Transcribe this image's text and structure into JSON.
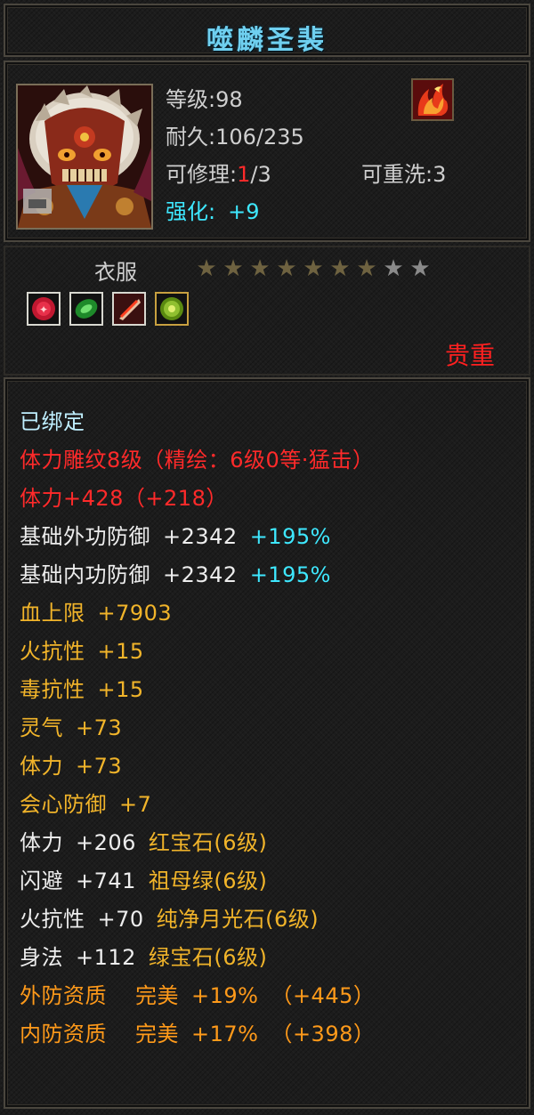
{
  "item": {
    "name": "噬麟圣裴",
    "level_label": "等级",
    "level": "98",
    "durability_label": "耐久",
    "durability": "106/235",
    "repair_label": "可修理",
    "repair_used": "1",
    "repair_max": "/3",
    "reset_label": "可重洗",
    "reset_count": "3",
    "enhance_label": "强化",
    "enhance_value": "+9",
    "category": "衣服",
    "stars_filled": 7,
    "stars_total": 9,
    "rarity": "贵重",
    "icons": {
      "portrait": "armor-portrait-icon",
      "item": "flame-emblem-icon",
      "gems": [
        "red-gem-icon",
        "green-gem-icon",
        "moonstone-icon",
        "emerald-icon"
      ]
    }
  },
  "attributes": {
    "bound": "已绑定",
    "engrave": "体力雕纹8级（精绘：6级0等·猛击）",
    "stamina_label": "体力+428",
    "stamina_bonus": "（+218）",
    "ext_def_label": "基础外功防御",
    "ext_def_value": "+2342",
    "ext_def_pct": "+195%",
    "int_def_label": "基础内功防御",
    "int_def_value": "+2342",
    "int_def_pct": "+195%",
    "hp_label": "血上限",
    "hp_value": "+7903",
    "fire_res_label": "火抗性",
    "fire_res_value": "+15",
    "poison_res_label": "毒抗性",
    "poison_res_value": "+15",
    "spirit_label": "灵气",
    "spirit_value": "+73",
    "body_label": "体力",
    "body_value": "+73",
    "crit_def_label": "会心防御",
    "crit_def_value": "+7"
  },
  "gems": [
    {
      "stat": "体力",
      "value": "+206",
      "name": "红宝石(6级)"
    },
    {
      "stat": "闪避",
      "value": "+741",
      "name": "祖母绿(6级)"
    },
    {
      "stat": "火抗性",
      "value": "+70",
      "name": "纯净月光石(6级)"
    },
    {
      "stat": "身法",
      "value": "+112",
      "name": "绿宝石(6级)"
    }
  ],
  "quality": [
    {
      "label": "外防资质",
      "grade": "完美",
      "pct": "+19%",
      "bonus": "（+445）"
    },
    {
      "label": "内防资质",
      "grade": "完美",
      "pct": "+17%",
      "bonus": "（+398）"
    }
  ],
  "colors": {
    "title": "#6fd0f0",
    "red": "#ff2a2a",
    "cyan": "#3ee8ff",
    "yellow": "#f1b42a",
    "orange": "#ff9a1a",
    "star_filled": "#6e6240",
    "star_empty": "#8a8a8a"
  }
}
